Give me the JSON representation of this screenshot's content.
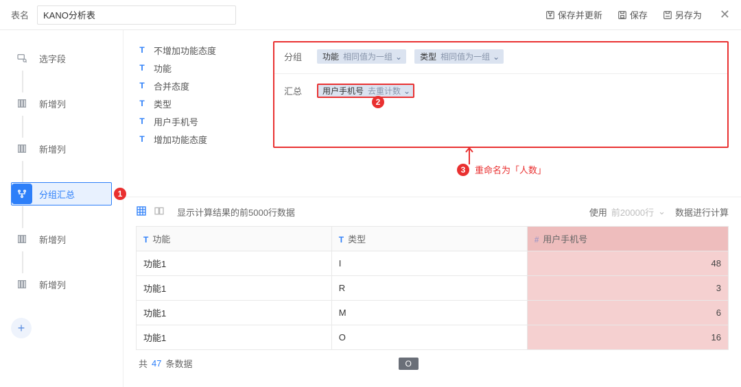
{
  "header": {
    "name_label": "表名",
    "table_name": "KANO分析表",
    "save_refresh": "保存并更新",
    "save": "保存",
    "save_as": "另存为"
  },
  "sidebar": {
    "items": [
      {
        "label": "选字段",
        "icon": "select-fields-icon",
        "selected": false
      },
      {
        "label": "新增列",
        "icon": "columns-icon",
        "selected": false
      },
      {
        "label": "新增列",
        "icon": "columns-icon",
        "selected": false
      },
      {
        "label": "分组汇总",
        "icon": "group-icon",
        "selected": true
      },
      {
        "label": "新增列",
        "icon": "columns-icon",
        "selected": false
      },
      {
        "label": "新增列",
        "icon": "columns-icon",
        "selected": false
      }
    ],
    "badge_step4": "1",
    "add_label": "+"
  },
  "fields": [
    "不增加功能态度",
    "功能",
    "合并态度",
    "类型",
    "用户手机号",
    "增加功能态度"
  ],
  "config": {
    "badge2": "2",
    "group_label": "分组",
    "group_chips": [
      {
        "main": "功能",
        "sub": "相同值为一组"
      },
      {
        "main": "类型",
        "sub": "相同值为一组"
      }
    ],
    "agg_label": "汇总",
    "agg_chip": {
      "main": "用户手机号",
      "sub": "去重计数"
    },
    "annotation_badge": "3",
    "annotation_text": "重命名为「人数」"
  },
  "result": {
    "note": "显示计算结果的前5000行数据",
    "use_label": "使用",
    "use_value": "前20000行",
    "compute_label": "数据进行计算",
    "columns": [
      {
        "prefix": "T",
        "label": "功能"
      },
      {
        "prefix": "T",
        "label": "类型"
      },
      {
        "prefix": "#",
        "label": "用户手机号"
      }
    ],
    "rows": [
      {
        "c0": "功能1",
        "c1": "I",
        "c2": "48"
      },
      {
        "c0": "功能1",
        "c1": "R",
        "c2": "3"
      },
      {
        "c0": "功能1",
        "c1": "M",
        "c2": "6"
      },
      {
        "c0": "功能1",
        "c1": "O",
        "c2": "16"
      }
    ],
    "footer_prefix": "共",
    "footer_total": "47",
    "footer_suffix": "条数据",
    "footer_badge": "O"
  }
}
